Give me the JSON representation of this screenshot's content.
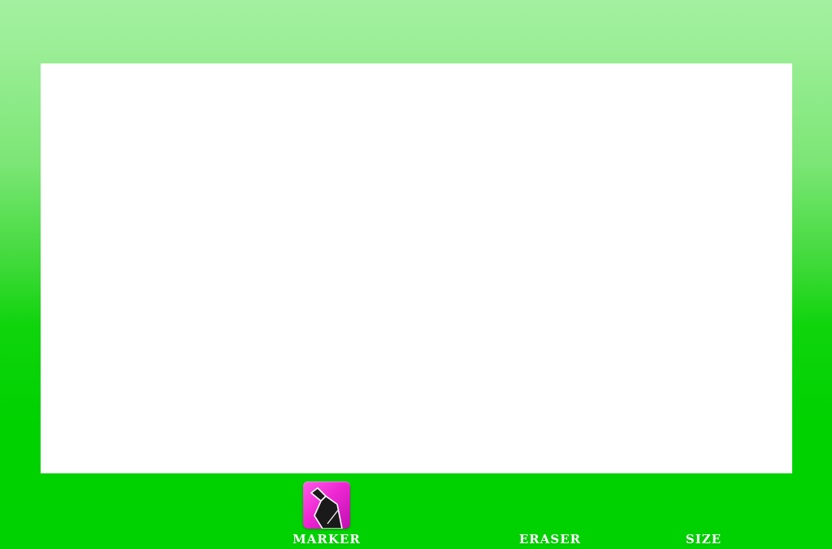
{
  "canvas": {
    "background": "#ffffff"
  },
  "theme": {
    "top_color": "#a3f0a0",
    "bottom_color": "#00d100",
    "marker_accent": "#ee28d4"
  },
  "toolbar": {
    "tools": [
      {
        "label": "MARKER",
        "icon": "marker-icon",
        "selected": true
      },
      {
        "label": "ERASER",
        "icon": "eraser-icon",
        "selected": false
      },
      {
        "label": "SIZE",
        "icon": "size-icon",
        "selected": false
      }
    ]
  }
}
